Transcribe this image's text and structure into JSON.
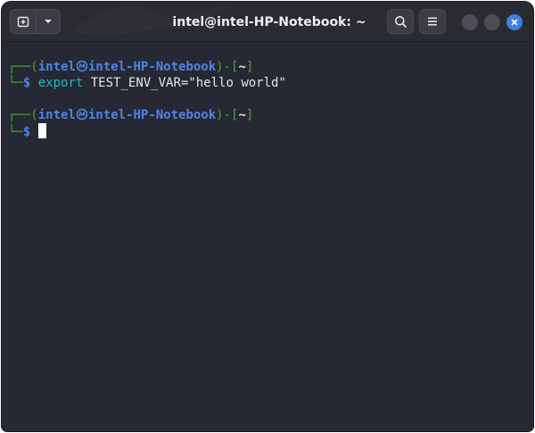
{
  "window": {
    "title": "intel@intel-HP-Notebook: ~"
  },
  "header": {
    "buttons": [
      {
        "name": "new-tab",
        "icon": "new-tab-icon"
      },
      {
        "name": "tab-menu",
        "icon": "chevron-down-icon"
      },
      {
        "name": "search",
        "icon": "search-icon"
      },
      {
        "name": "menu",
        "icon": "hamburger-menu-icon"
      }
    ],
    "controls": [
      "minimize",
      "maximize",
      "close"
    ],
    "close_color": "#3c7fe6"
  },
  "terminal": {
    "prompt": {
      "open": "┌──(",
      "user": "intel",
      "host": "intel-HP-Notebook",
      "mid": ")-[",
      "cwd": "~",
      "close": "]",
      "lead": "└─",
      "symbol": "$"
    },
    "command_1": {
      "keyword": "export",
      "args": "TEST_ENV_VAR=\"hello world\""
    }
  },
  "colors": {
    "background": "#262833",
    "prompt_frame": "#4aa33a",
    "prompt_user_host": "#4b86e8",
    "command_keyword": "#16c0c4",
    "text": "#e6e6e6"
  }
}
